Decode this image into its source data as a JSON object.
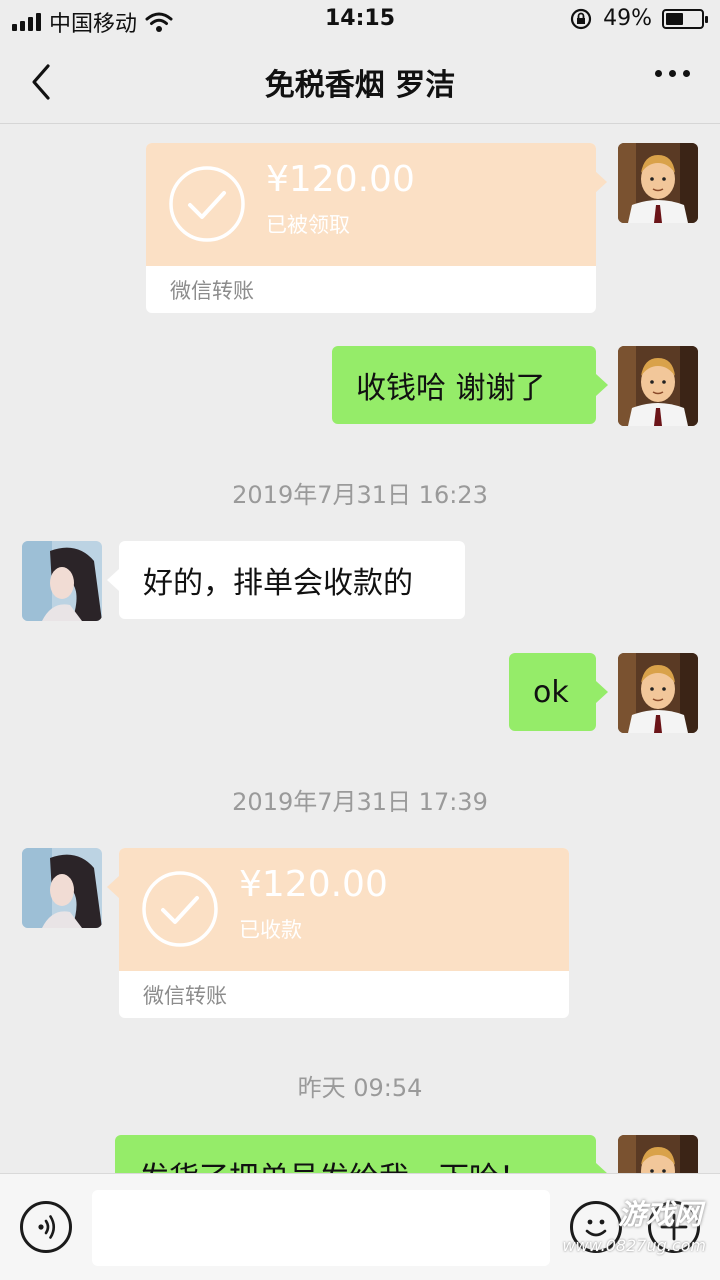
{
  "status_bar": {
    "carrier": "中国移动",
    "time": "14:15",
    "battery_percent": "49%",
    "battery_level": 0.49,
    "icons": [
      "signal-icon",
      "wifi-icon",
      "rotation-lock-icon",
      "battery-icon"
    ]
  },
  "nav": {
    "title": "免税香烟  罗洁",
    "back_icon": "chevron-left-icon",
    "more_icon": "more-dots-icon"
  },
  "messages": [
    {
      "kind": "transfer",
      "side": "right",
      "amount": "¥120.00",
      "status": "已被领取",
      "footer": "微信转账"
    },
    {
      "kind": "text",
      "side": "right",
      "text": "收钱哈  谢谢了"
    },
    {
      "kind": "time",
      "text": "2019年7月31日 16:23"
    },
    {
      "kind": "text",
      "side": "left",
      "text": "好的，排单会收款的"
    },
    {
      "kind": "text",
      "side": "right",
      "text": "ok"
    },
    {
      "kind": "time",
      "text": "2019年7月31日 17:39"
    },
    {
      "kind": "transfer",
      "side": "left",
      "amount": "¥120.00",
      "status": "已收款",
      "footer": "微信转账"
    },
    {
      "kind": "time",
      "text": "昨天 09:54"
    },
    {
      "kind": "text",
      "side": "right",
      "text": "发货了把单号发给我一下哈！"
    }
  ],
  "input_bar": {
    "voice_icon": "voice-icon",
    "emoji_icon": "emoji-icon",
    "plus_icon": "plus-icon",
    "placeholder": ""
  },
  "watermark": {
    "main": "游戏网",
    "sub": "www.0827ug.com"
  },
  "colors": {
    "background": "#ededed",
    "bubble_green": "#95ec69",
    "transfer_orange": "#fbe0c5",
    "timestamp_gray": "#9a9a9a"
  }
}
